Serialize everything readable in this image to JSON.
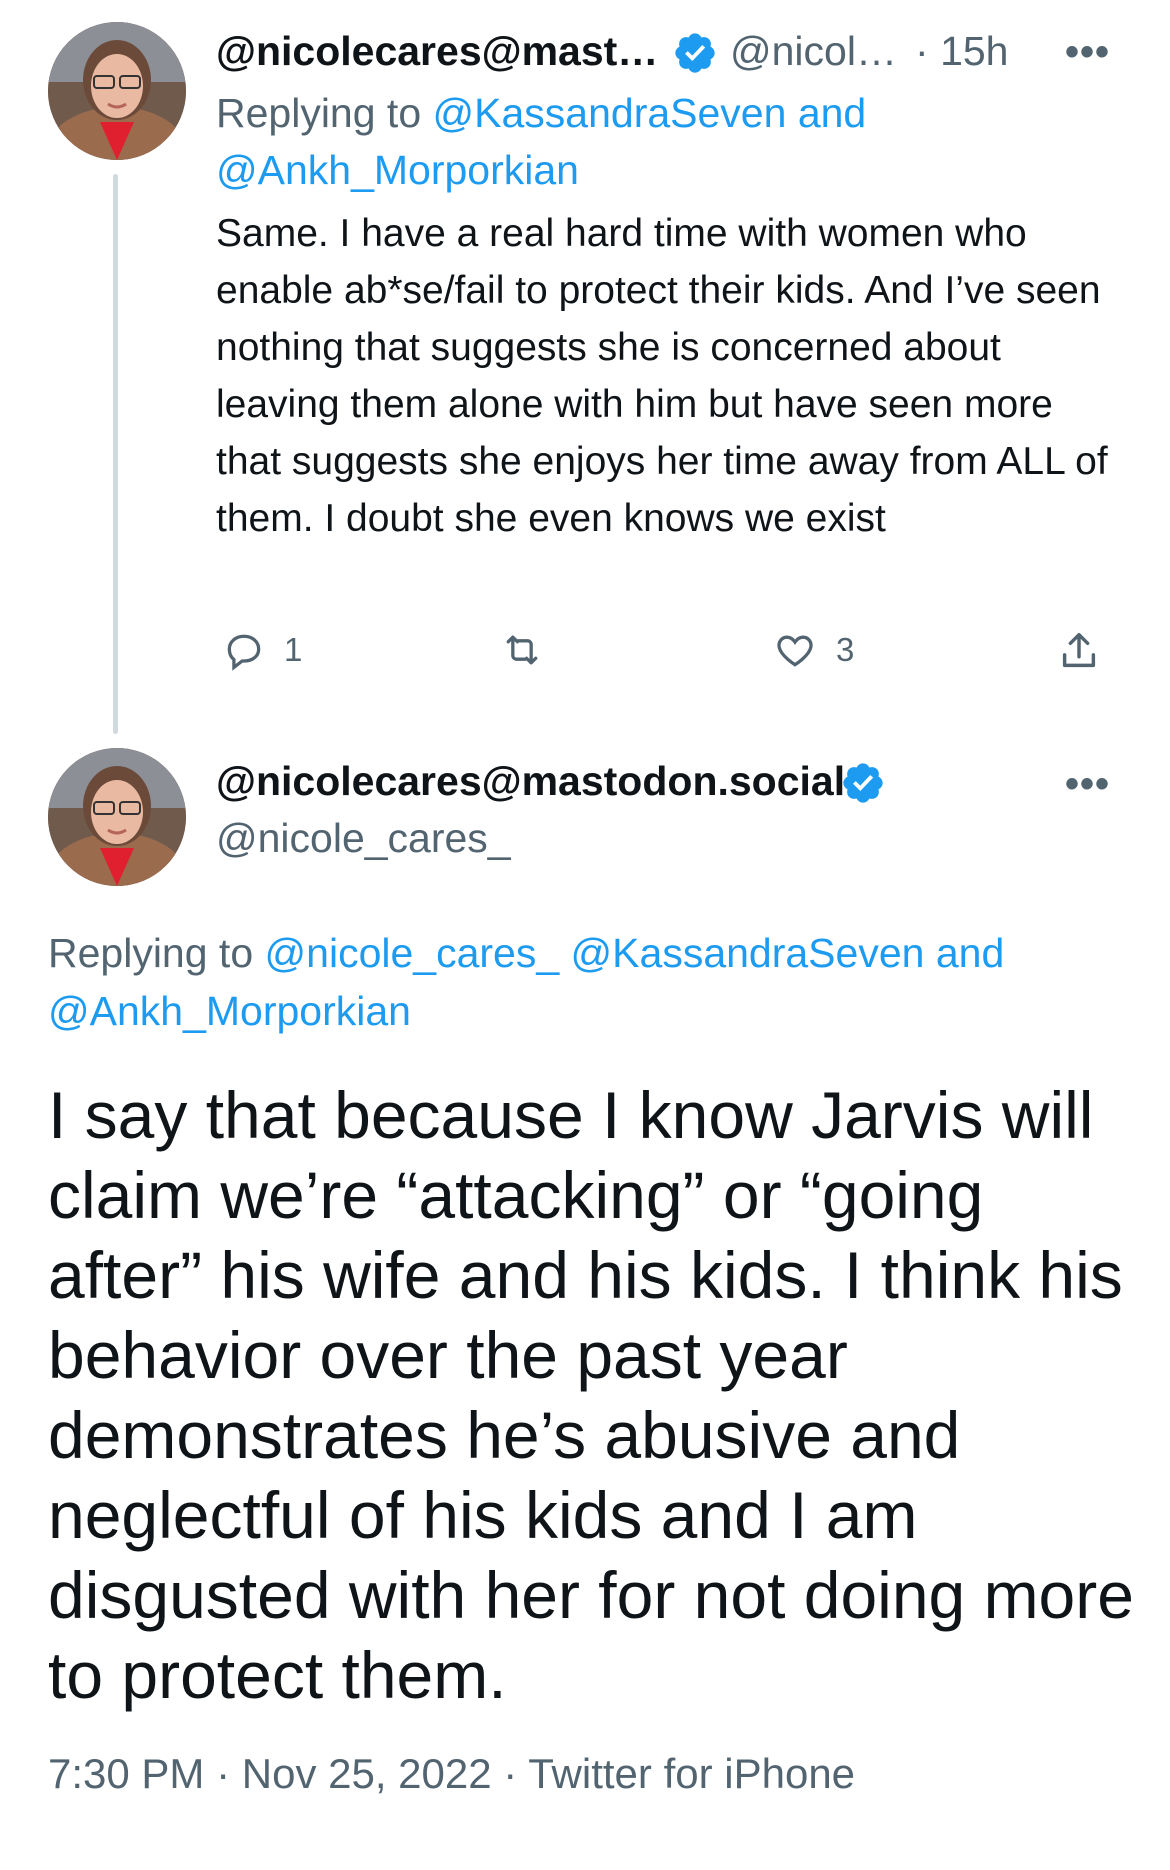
{
  "tweet1": {
    "display_name": "@nicolecares@mast…",
    "handle": "@nicol…",
    "dot": "·",
    "time": "15h",
    "more_label": "•••",
    "replying_prefix": "Replying to",
    "replying_user1": "@KassandraSeven",
    "replying_and": "and",
    "replying_user2": "@Ankh_Morporkian",
    "body": "Same. I have a real hard time with women who enable ab*se/fail to protect their kids. And I’ve seen nothing that suggests she is concerned about leaving them alone with him but have seen more that suggests she enjoys her time away from ALL of them. I doubt she even knows we exist",
    "reply_count": "1",
    "retweet_count": "",
    "like_count": "3"
  },
  "tweet2": {
    "display_name": "@nicolecares@mastodon.social",
    "handle": "@nicole_cares_",
    "more_label": "•••",
    "replying_prefix": "Replying to",
    "replying_user1": "@nicole_cares_",
    "replying_user2": "@KassandraSeven",
    "replying_and": "and",
    "replying_user3": "@Ankh_Morporkian",
    "body": "I say that because I know Jarvis will claim we’re “attacking” or “going after” his wife and his kids. I think his behavior over the past year demonstrates he’s abusive and neglectful of his kids and I am disgusted with her for not doing more to protect them.",
    "time": "7:30 PM",
    "sep1": "·",
    "date": "Nov 25, 2022",
    "sep2": "·",
    "source": "Twitter for iPhone"
  },
  "colors": {
    "link": "#1d9bf0",
    "muted": "#536471",
    "text": "#0f1419",
    "thread_line": "#cfd9de"
  },
  "icons": {
    "verified": "verified-badge-icon",
    "reply": "reply-icon",
    "retweet": "retweet-icon",
    "like": "heart-icon",
    "share": "share-icon",
    "more": "more-dots-icon"
  }
}
